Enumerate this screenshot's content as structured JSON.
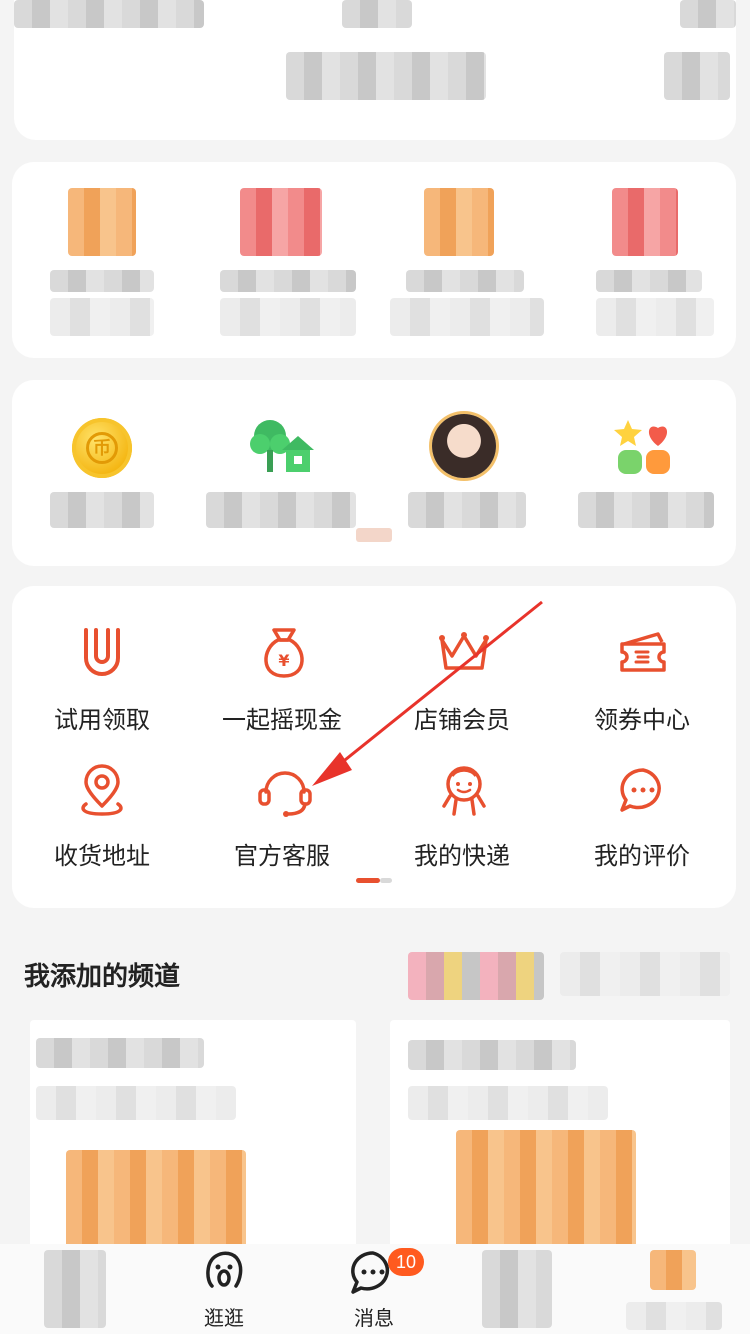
{
  "services": {
    "row1": [
      {
        "label": "试用领取",
        "icon": "u-trial-icon"
      },
      {
        "label": "一起摇现金",
        "icon": "money-bag-icon"
      },
      {
        "label": "店铺会员",
        "icon": "crown-icon"
      },
      {
        "label": "领券中心",
        "icon": "coupon-icon"
      }
    ],
    "row2": [
      {
        "label": "收货地址",
        "icon": "location-pin-icon"
      },
      {
        "label": "官方客服",
        "icon": "headset-icon"
      },
      {
        "label": "我的快递",
        "icon": "courier-icon"
      },
      {
        "label": "我的评价",
        "icon": "chat-bubble-icon"
      }
    ]
  },
  "channels": {
    "title": "我添加的频道"
  },
  "tabbar": {
    "tab_browse": "逛逛",
    "tab_messages": "消息",
    "message_badge": "10"
  },
  "colors": {
    "accent": "#e8502f",
    "arrow": "#e8332b",
    "badge": "#ff5a1f"
  }
}
